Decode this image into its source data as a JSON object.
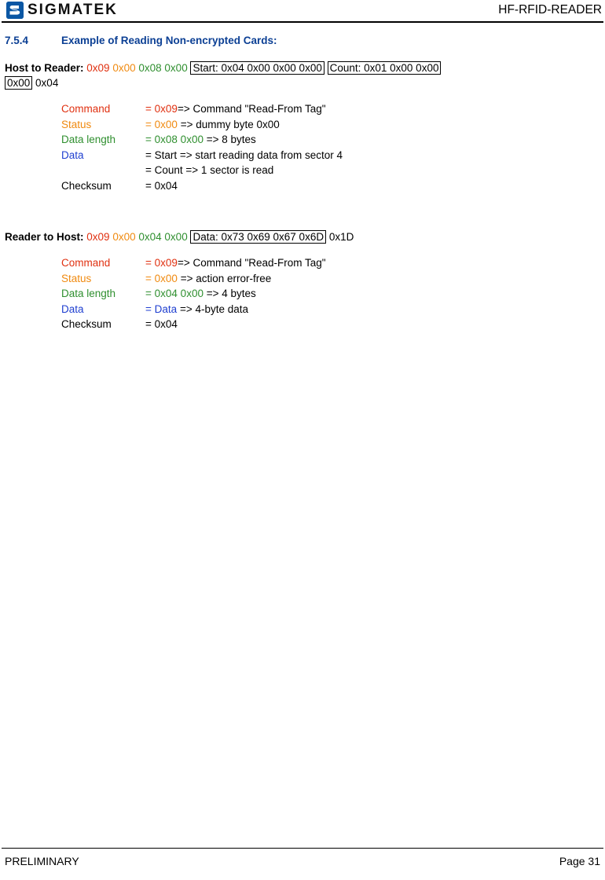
{
  "header": {
    "logo_text": "SIGMATEK",
    "logo_icon": "sigmatek-s-logo-icon",
    "document_title": "HF-RFID-READER"
  },
  "section": {
    "number": "7.5.4",
    "title": "Example of Reading Non-encrypted Cards:"
  },
  "host_to_reader": {
    "label": "Host to Reader:",
    "b1": "0x09",
    "b2": "0x00",
    "b3": "0x08",
    "b4": "0x00",
    "box_start": "Start: 0x04 0x00 0x00 0x00",
    "box_count": "Count: 0x01 0x00 0x00",
    "box_count2": "0x00",
    "checksum": "0x04",
    "rows": [
      {
        "key": "Command",
        "eq": "=",
        "val": "0x09",
        "rest": "=> Command \"Read-From Tag\""
      },
      {
        "key": "Status",
        "eq": "=",
        "val": "0x00",
        "rest": " => dummy byte 0x00"
      },
      {
        "key": "Data length",
        "eq": "=",
        "val": " 0x08 0x00",
        "rest": " => 8 bytes"
      },
      {
        "key": "Data",
        "eq": "=",
        "val": "",
        "rest": " Start => start reading data from sector 4"
      },
      {
        "key": "",
        "eq": "=",
        "val": "",
        "rest": " Count => 1 sector is read"
      },
      {
        "key": "Checksum",
        "eq": "=",
        "val": "",
        "rest": " 0x04"
      }
    ]
  },
  "reader_to_host": {
    "label": "Reader to Host:",
    "b1": "0x09",
    "b2": "0x00",
    "b3": "0x04",
    "b4": "0x00",
    "box_data": "Data: 0x73 0x69 0x67 0x6D",
    "checksum": "0x1D",
    "rows": [
      {
        "key": "Command",
        "eq": "=",
        "val": "0x09",
        "rest": "=> Command \"Read-From Tag\""
      },
      {
        "key": "Status",
        "eq": "=",
        "val": "0x00",
        "rest": " => action error-free"
      },
      {
        "key": "Data length",
        "eq": "=",
        "val": "0x04 0x00",
        "rest": " => 4 bytes"
      },
      {
        "key": "Data",
        "eq": "=",
        "val": "Data",
        "rest": " => 4-byte data"
      },
      {
        "key": "Checksum",
        "eq": "=",
        "val": "",
        "rest": " 0x04"
      }
    ]
  },
  "footer": {
    "left": "PRELIMINARY",
    "right": "Page 31"
  },
  "colors": {
    "heading_blue": "#0b3f94",
    "red": "#e03010",
    "orange": "#f08a10",
    "green": "#2f8f2f",
    "blue": "#1f3fd0"
  }
}
